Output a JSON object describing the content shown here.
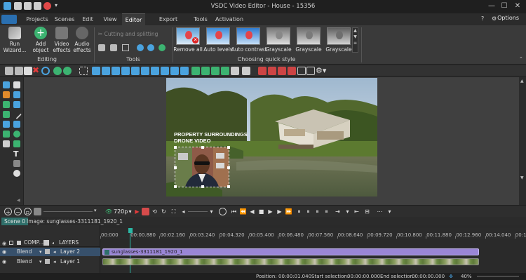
{
  "window": {
    "title": "VSDC Video Editor - House - 15356"
  },
  "menu": {
    "tabs": [
      "Projects",
      "Scenes",
      "Edit",
      "View",
      "Editor",
      "Export project",
      "Tools",
      "Activation"
    ],
    "active": "Editor",
    "options_label": "Options"
  },
  "ribbon": {
    "editing": {
      "group_label": "Editing",
      "run_wizard": "Run\nWizard...",
      "add_object": "Add\nobject",
      "video_effects": "Video\neffects",
      "audio_effects": "Audio\neffects"
    },
    "tools": {
      "group_label": "Tools",
      "cutting": "Cutting and splitting"
    },
    "quick_style": {
      "group_label": "Choosing quick style",
      "items": [
        "Remove all",
        "Auto levels",
        "Auto contrast",
        "Grayscale",
        "Grayscale",
        "Grayscale"
      ]
    }
  },
  "canvas": {
    "overlay_line1": "PROPERTY SURROUNDINGS",
    "overlay_line2": "DRONE VIDEO"
  },
  "transport": {
    "quality": "720p"
  },
  "scenes": {
    "scene_tab": "Scene 0",
    "image_tab": "Image: sunglasses-3311181_1920_1"
  },
  "timeline": {
    "comp_label": "COMP...",
    "layers_label": "LAYERS",
    "ruler": [
      "00:000",
      "00:00.880",
      "00:02.160",
      "00:03.240",
      "00:04.320",
      "00:05.400",
      "00:06.480",
      "00:07.560",
      "00:08.640",
      "00:09.720",
      "00:10.800",
      "00:11.880",
      "00:12.960",
      "00:14.040",
      "00:15.120"
    ],
    "layers": [
      {
        "blend": "Blend",
        "name": "Layer 2",
        "clip": "sunglasses-3311181_1920_1"
      },
      {
        "blend": "Blend",
        "name": "Layer 1"
      }
    ]
  },
  "status": {
    "position_label": "Position:",
    "position": "00:00:01.040",
    "start_label": "Start selection:",
    "start": "00:00:00.000",
    "end_label": "End selection:",
    "end": "00:00:00.000",
    "zoom": "40%"
  }
}
